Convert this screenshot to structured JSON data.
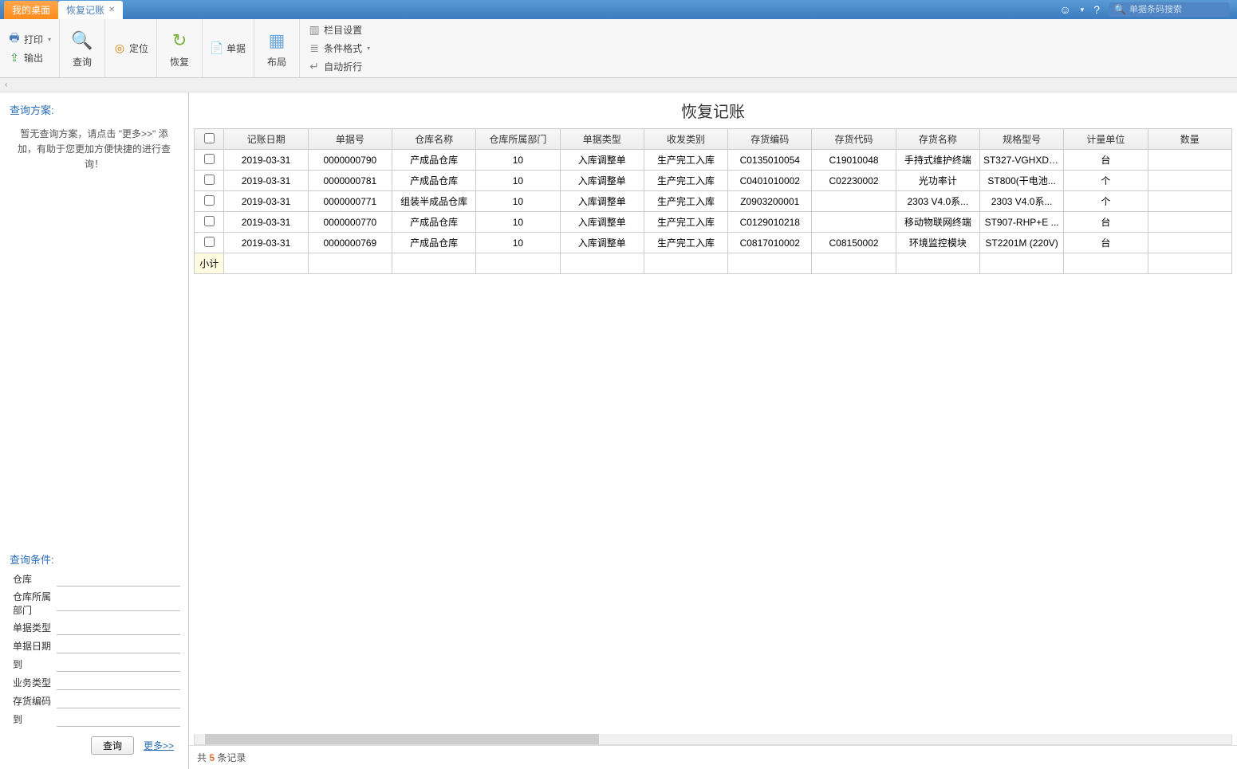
{
  "tabs": {
    "home": "我的桌面",
    "active": "恢复记账"
  },
  "search": {
    "placeholder": "单据条码搜索"
  },
  "ribbon": {
    "print": "打印",
    "export": "输出",
    "query": "查询",
    "locate": "定位",
    "restore": "恢复",
    "doc": "单据",
    "layout": "布局",
    "columns": "栏目设置",
    "condformat": "条件格式",
    "autowrap": "自动折行"
  },
  "page_title": "恢复记账",
  "sidebar": {
    "plan_title": "查询方案:",
    "plan_msg": "暂无查询方案，请点击 \"更多>>\" 添加，有助于您更加方便快捷的进行查询！",
    "cond_title": "查询条件:",
    "conds": [
      "仓库",
      "仓库所属部门",
      "单据类型",
      "单据日期",
      "到",
      "业务类型",
      "存货编码",
      "到"
    ],
    "query_btn": "查询",
    "more": "更多>>"
  },
  "grid": {
    "headers": [
      "记账日期",
      "单据号",
      "仓库名称",
      "仓库所属部门",
      "单据类型",
      "收发类别",
      "存货编码",
      "存货代码",
      "存货名称",
      "规格型号",
      "计量单位",
      "数量"
    ],
    "rows": [
      [
        "2019-03-31",
        "0000000790",
        "产成品仓库",
        "10",
        "入库调整单",
        "生产完工入库",
        "C0135010054",
        "C19010048",
        "手持式维护终端",
        "ST327-VGHXDT...",
        "台",
        ""
      ],
      [
        "2019-03-31",
        "0000000781",
        "产成品仓库",
        "10",
        "入库调整单",
        "生产完工入库",
        "C0401010002",
        "C02230002",
        "光功率计",
        "ST800(干电池...",
        "个",
        ""
      ],
      [
        "2019-03-31",
        "0000000771",
        "组装半成品仓库",
        "10",
        "入库调整单",
        "生产完工入库",
        "Z0903200001",
        "",
        "2303 V4.0系...",
        "2303 V4.0系...",
        "个",
        ""
      ],
      [
        "2019-03-31",
        "0000000770",
        "产成品仓库",
        "10",
        "入库调整单",
        "生产完工入库",
        "C0129010218",
        "",
        "移动物联网终端",
        "ST907-RHP+E ...",
        "台",
        ""
      ],
      [
        "2019-03-31",
        "0000000769",
        "产成品仓库",
        "10",
        "入库调整单",
        "生产完工入库",
        "C0817010002",
        "C08150002",
        "环境监控模块",
        "ST2201M (220V)",
        "台",
        ""
      ]
    ],
    "subtotal": "小计"
  },
  "footer": {
    "prefix": "共",
    "count": "5",
    "suffix": "条记录"
  }
}
